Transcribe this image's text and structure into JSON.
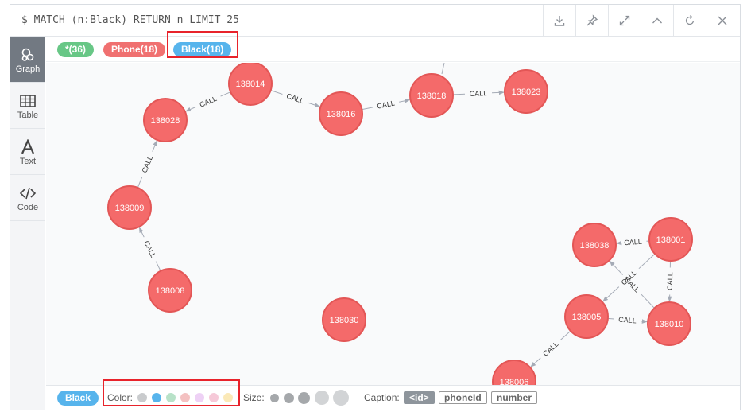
{
  "query": "$ MATCH (n:Black) RETURN n LIMIT 25",
  "toolbar_icons": [
    "download-icon",
    "pin-icon",
    "expand-icon",
    "collapse-icon",
    "refresh-icon",
    "close-icon"
  ],
  "sidebar": {
    "items": [
      {
        "label": "Graph",
        "icon": "graph-icon"
      },
      {
        "label": "Table",
        "icon": "table-icon"
      },
      {
        "label": "Text",
        "icon": "text-icon"
      },
      {
        "label": "Code",
        "icon": "code-icon"
      }
    ]
  },
  "labels": [
    {
      "label": "*(36)",
      "color": "#68c786"
    },
    {
      "label": "Phone(18)",
      "color": "#f07070"
    },
    {
      "label": "Black(18)",
      "color": "#57b4ec"
    }
  ],
  "node_color": "#f46a6a",
  "node_border": "#e35656",
  "nodes": [
    {
      "id": "138014"
    },
    {
      "id": "138028"
    },
    {
      "id": "138016"
    },
    {
      "id": "138018"
    },
    {
      "id": "138023"
    },
    {
      "id": "138009"
    },
    {
      "id": "138008"
    },
    {
      "id": "138030"
    },
    {
      "id": "138038"
    },
    {
      "id": "138001"
    },
    {
      "id": "138005"
    },
    {
      "id": "138010"
    },
    {
      "id": "138006"
    }
  ],
  "relationships": [
    {
      "from": "138014",
      "to": "138028",
      "type": "CALL"
    },
    {
      "from": "138014",
      "to": "138016",
      "type": "CALL"
    },
    {
      "from": "138016",
      "to": "138018",
      "type": "CALL"
    },
    {
      "from": "138018",
      "to": "138023",
      "type": "CALL"
    },
    {
      "from": "138009",
      "to": "138028",
      "type": "CALL"
    },
    {
      "from": "138008",
      "to": "138009",
      "type": "CALL"
    },
    {
      "from": "138001",
      "to": "138038",
      "type": "CALL"
    },
    {
      "from": "138001",
      "to": "138005",
      "type": "CALL"
    },
    {
      "from": "138010",
      "to": "138038",
      "type": "CALL"
    },
    {
      "from": "138001",
      "to": "138010",
      "type": "CALL"
    },
    {
      "from": "138005",
      "to": "138010",
      "type": "CALL"
    },
    {
      "from": "138005",
      "to": "138006",
      "type": "CALL"
    }
  ],
  "footer": {
    "selected_label": "Black",
    "selected_color": "#57b4ec",
    "color_label": "Color:",
    "colors": [
      "#c9cbcd",
      "#57b4ec",
      "#b8e2c8",
      "#f4c1c1",
      "#eed1f5",
      "#f6c9d8",
      "#fbe9b7"
    ],
    "size_label": "Size:",
    "caption_label": "Caption:",
    "captions": [
      "<id>",
      "phoneId",
      "number"
    ]
  }
}
